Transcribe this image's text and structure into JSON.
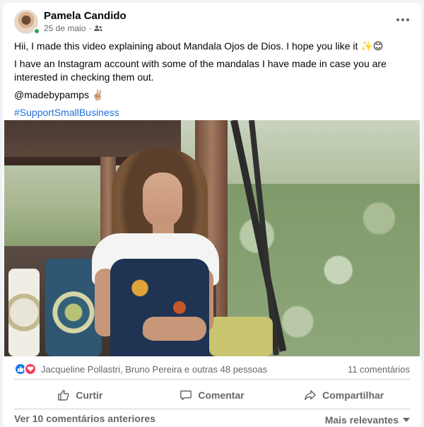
{
  "post": {
    "author": "Pamela Candido",
    "date": "25 de maio",
    "separator": "·",
    "audience_icon": "friends-icon",
    "more_icon": "more-options-icon",
    "paragraphs": [
      "Hii, I made this video explaining about Mandala Ojos de Dios. I hope you like it ✨😊",
      "I have an Instagram account with some of the mandalas I have made in case you are interested in checking them out.",
      "@madebypamps ✌🏼"
    ],
    "hashtag": "#SupportSmallBusiness"
  },
  "reactions": {
    "icons": [
      "like-icon",
      "love-icon"
    ],
    "names": "Jacqueline Pollastri, Bruno Pereira e outras 48 pessoas",
    "comments": "11 comentários"
  },
  "actions": {
    "like": "Curtir",
    "comment": "Comentar",
    "share": "Compartilhar"
  },
  "footer": {
    "view_previous": "Ver 10 comentários anteriores",
    "sort": "Mais relevantes"
  },
  "colors": {
    "link": "#216fdb",
    "like": "#1877f2",
    "love": "#f33e58",
    "online": "#31a24c",
    "secondary_text": "#65676b"
  }
}
